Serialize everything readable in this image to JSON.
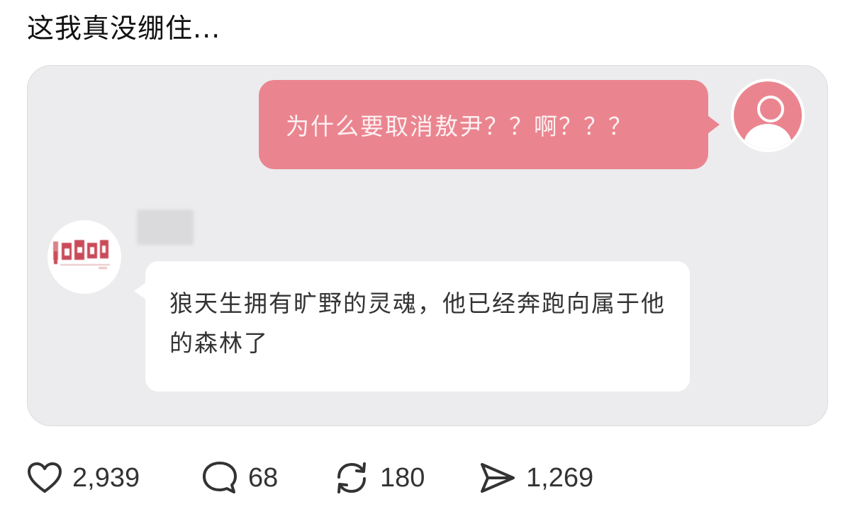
{
  "post": {
    "text": "这我真没绷住..."
  },
  "chat": {
    "outgoing_message": "为什么要取消敖尹？？啊？？？",
    "incoming_message": "狼天生拥有旷野的灵魂，他已经奔跑向属于他的森林了"
  },
  "actions": {
    "likes": "2,939",
    "comments": "68",
    "reposts": "180",
    "shares": "1,269"
  },
  "icons": {
    "like": "heart-icon",
    "comment": "comment-bubble-icon",
    "repost": "repost-arrows-icon",
    "share": "send-icon",
    "user_avatar": "user-silhouette-icon"
  },
  "colors": {
    "outgoing_bubble": "#ea8590",
    "media_background": "#ececee",
    "incoming_bubble": "#ffffff"
  }
}
